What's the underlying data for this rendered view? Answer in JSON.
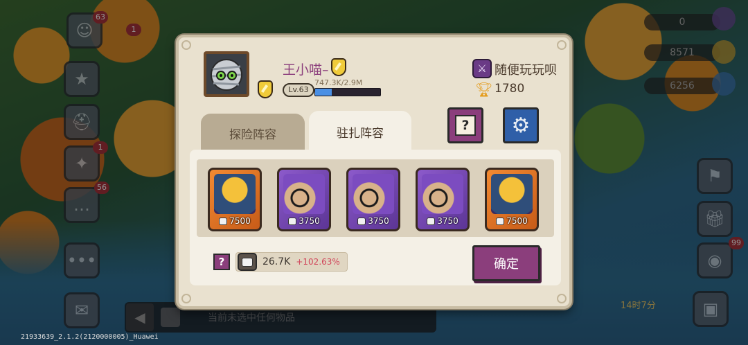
{
  "hud": {
    "badges": {
      "profile": "63",
      "hero_count": "1",
      "book": "1",
      "chat": "56",
      "egg": "99"
    },
    "resources": [
      "0",
      "8571",
      "6256"
    ],
    "egg_timer": "14时7分",
    "bottom_bar_text": "当前未选中任何物品",
    "build_label": "21933639_2.1.2(2120000005)_Huawei"
  },
  "player": {
    "name": "王小喵–",
    "level": "Lv.63",
    "xp_text": "747.3K/2.9M",
    "xp_fraction": 0.26,
    "guild_name": "随便玩玩呗",
    "trophies": "1780"
  },
  "tabs": [
    {
      "label": "探险阵容",
      "active": false
    },
    {
      "label": "驻扎阵容",
      "active": true
    }
  ],
  "buttons": {
    "help": "?",
    "confirm": "确定"
  },
  "lineup": [
    {
      "power": "7500",
      "rarity": "orange",
      "icon": "golden-mask-hero-icon"
    },
    {
      "power": "3750",
      "rarity": "purple",
      "icon": "owl-wizard-hero-icon"
    },
    {
      "power": "3750",
      "rarity": "purple",
      "icon": "owl-wizard-hero-icon"
    },
    {
      "power": "3750",
      "rarity": "purple",
      "icon": "owl-wizard-hero-icon"
    },
    {
      "power": "7500",
      "rarity": "orange",
      "icon": "golden-mask-hero-icon"
    }
  ],
  "total_power": {
    "value": "26.7K",
    "delta": "+102.63%"
  },
  "colors": {
    "accent_purple": "#8b3e7c",
    "accent_blue": "#2f5fa8",
    "panel": "#e9e1cf",
    "delta": "#d1455a"
  }
}
